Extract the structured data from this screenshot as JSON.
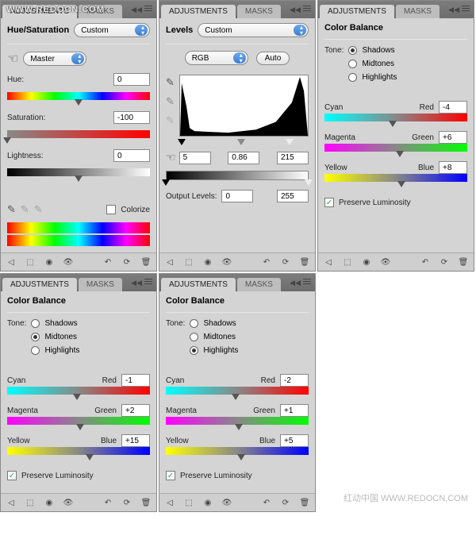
{
  "watermark_top": "WWW.REDOCN.COM",
  "watermark_bottom": "红动中国 WWW.REDOCN.COM",
  "tabs": {
    "adjustments": "ADJUSTMENTS",
    "masks": "MASKS"
  },
  "hue_sat": {
    "title": "Hue/Saturation",
    "preset": "Custom",
    "channel": "Master",
    "hue_label": "Hue:",
    "hue_val": "0",
    "sat_label": "Saturation:",
    "sat_val": "-100",
    "light_label": "Lightness:",
    "light_val": "0",
    "colorize_label": "Colorize"
  },
  "levels": {
    "title": "Levels",
    "preset": "Custom",
    "channel": "RGB",
    "auto": "Auto",
    "in_black": "5",
    "in_gamma": "0.86",
    "in_white": "215",
    "out_label": "Output Levels:",
    "out_black": "0",
    "out_white": "255"
  },
  "cb_shadows": {
    "title": "Color Balance",
    "tone_label": "Tone:",
    "shadows": "Shadows",
    "midtones": "Midtones",
    "highlights": "Highlights",
    "cyan": "Cyan",
    "red": "Red",
    "magenta": "Magenta",
    "green": "Green",
    "yellow": "Yellow",
    "blue": "Blue",
    "cr_val": "-4",
    "mg_val": "+6",
    "yb_val": "+8",
    "preserve": "Preserve Luminosity"
  },
  "cb_midtones": {
    "title": "Color Balance",
    "tone_label": "Tone:",
    "shadows": "Shadows",
    "midtones": "Midtones",
    "highlights": "Highlights",
    "cyan": "Cyan",
    "red": "Red",
    "magenta": "Magenta",
    "green": "Green",
    "yellow": "Yellow",
    "blue": "Blue",
    "cr_val": "-1",
    "mg_val": "+2",
    "yb_val": "+15",
    "preserve": "Preserve Luminosity"
  },
  "cb_highlights": {
    "title": "Color Balance",
    "tone_label": "Tone:",
    "shadows": "Shadows",
    "midtones": "Midtones",
    "highlights": "Highlights",
    "cyan": "Cyan",
    "red": "Red",
    "magenta": "Magenta",
    "green": "Green",
    "yellow": "Yellow",
    "blue": "Blue",
    "cr_val": "-2",
    "mg_val": "+1",
    "yb_val": "+5",
    "preserve": "Preserve Luminosity"
  }
}
